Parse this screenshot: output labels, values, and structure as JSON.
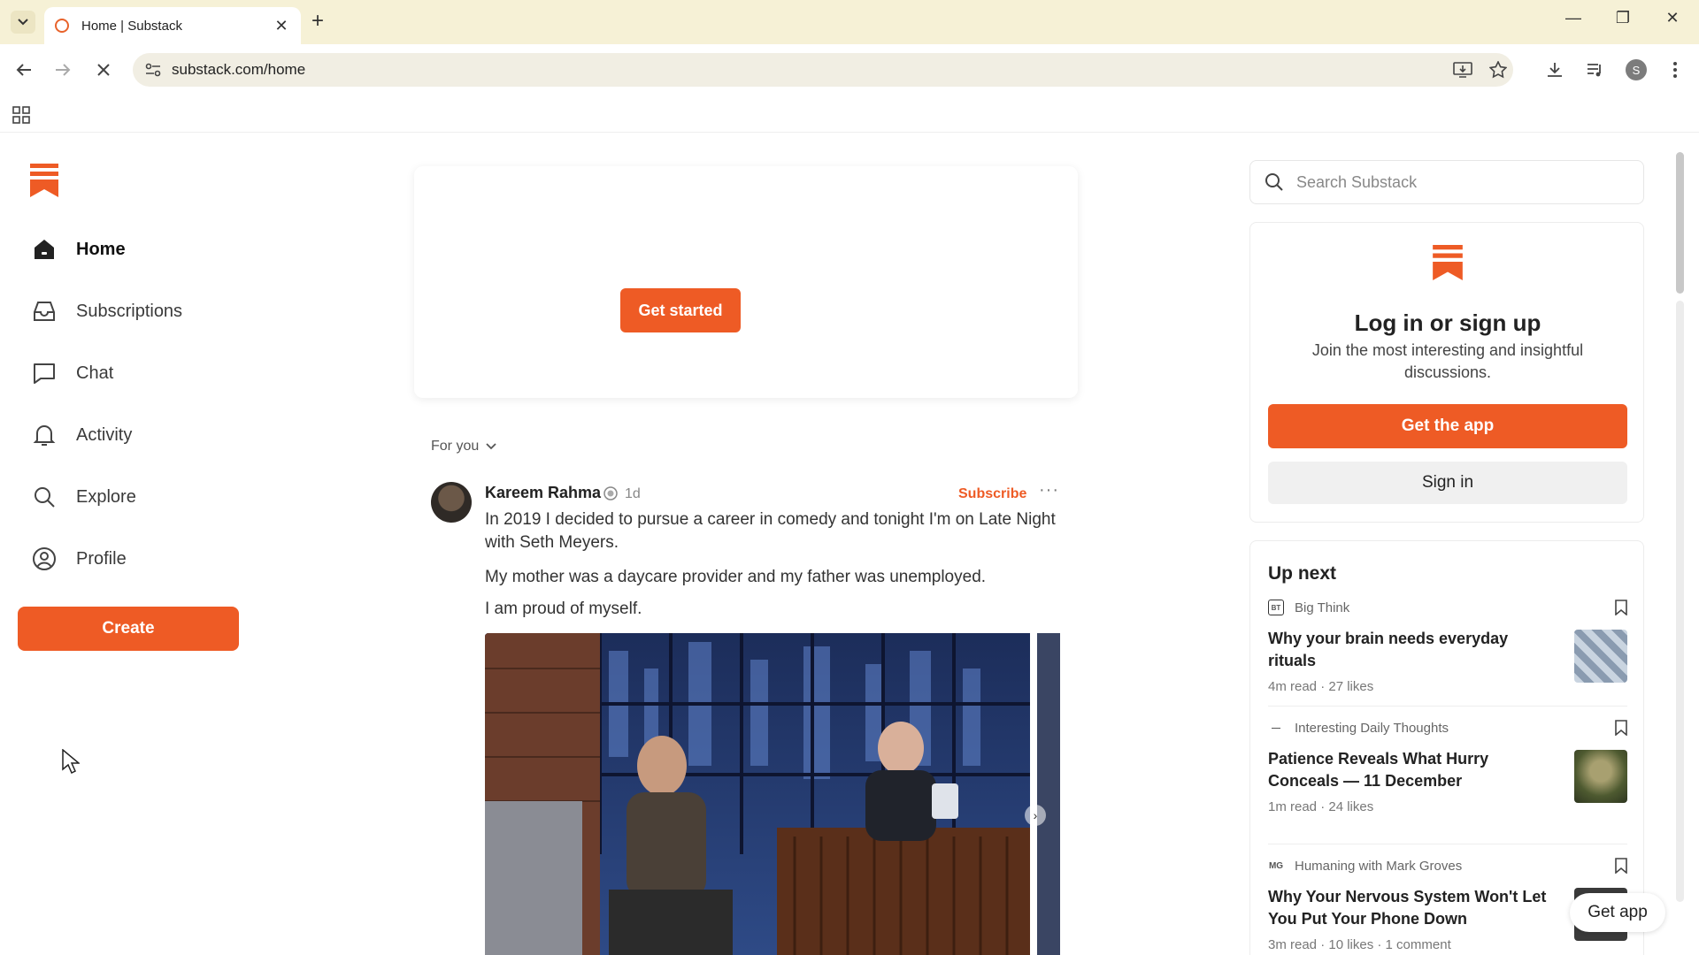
{
  "browser": {
    "tab_title": "Home | Substack",
    "url": "substack.com/home",
    "profile_initial": "S"
  },
  "nav": {
    "items": [
      {
        "label": "Home",
        "icon": "home-icon"
      },
      {
        "label": "Subscriptions",
        "icon": "inbox-icon"
      },
      {
        "label": "Chat",
        "icon": "chat-icon"
      },
      {
        "label": "Activity",
        "icon": "bell-icon"
      },
      {
        "label": "Explore",
        "icon": "search-icon"
      },
      {
        "label": "Profile",
        "icon": "profile-icon"
      }
    ],
    "create_label": "Create"
  },
  "promo": {
    "button_label": "Get started"
  },
  "feed": {
    "filter_label": "For you",
    "post": {
      "author": "Kareem Rahma",
      "time": "1d",
      "subscribe_label": "Subscribe",
      "more_label": "···",
      "paragraphs": [
        "In 2019 I decided to pursue a career in comedy and tonight I'm on Late Night with Seth Meyers.",
        "My mother was a daycare provider and my father was unemployed.",
        "I am proud of myself."
      ]
    }
  },
  "sidebar": {
    "search_placeholder": "Search Substack",
    "login": {
      "title": "Log in or sign up",
      "subtitle": "Join the most interesting and insightful discussions.",
      "get_app_label": "Get the app",
      "sign_in_label": "Sign in"
    },
    "up_next": {
      "title": "Up next",
      "stories": [
        {
          "publication": "Big Think",
          "pub_icon": "BT",
          "headline": "Why your brain needs everyday rituals",
          "meta": "4m read · 27 likes"
        },
        {
          "publication": "Interesting Daily Thoughts",
          "pub_icon": "—",
          "headline": "Patience Reveals What Hurry Conceals — 11 December",
          "meta": "1m read · 24 likes"
        },
        {
          "publication": "Humaning with Mark Groves",
          "pub_icon": "MG",
          "headline": "Why Your Nervous System Won't Let You Put Your Phone Down",
          "meta": "3m read · 10 likes · 1 comment"
        }
      ]
    },
    "get_app_float_label": "Get app"
  },
  "colors": {
    "brand": "#ee5b25",
    "chrome": "#f6f1d6"
  }
}
